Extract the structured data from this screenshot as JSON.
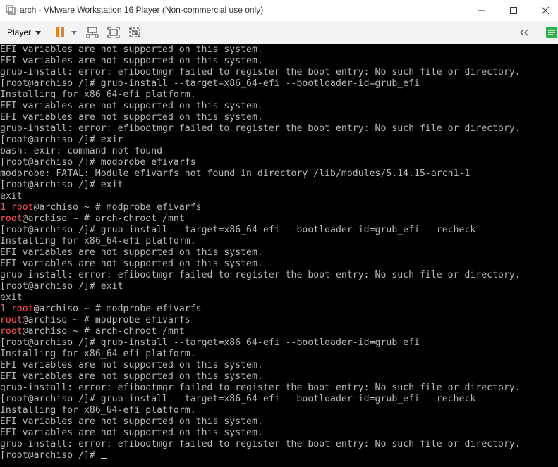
{
  "window": {
    "title": "arch - VMware Workstation 16 Player (Non-commercial use only)"
  },
  "toolbar": {
    "player_label": "Player"
  },
  "colors": {
    "terminal_bg": "#000000",
    "terminal_fg": "#b8b8b8",
    "prompt_red": "#ff5555",
    "pause_orange": "#f07a1a",
    "sidebar_green": "#2fb24c"
  },
  "terminal": {
    "lines": [
      {
        "t": "EFI variables are not supported on this system."
      },
      {
        "t": "EFI variables are not supported on this system."
      },
      {
        "t": "grub-install: error: efibootmgr failed to register the boot entry: No such file or directory."
      },
      {
        "t": "[root@archiso /]# grub-install --target=x86_64-efi --bootloader-id=grub_efi"
      },
      {
        "t": "Installing for x86_64-efi platform."
      },
      {
        "t": "EFI variables are not supported on this system."
      },
      {
        "t": "EFI variables are not supported on this system."
      },
      {
        "t": "grub-install: error: efibootmgr failed to register the boot entry: No such file or directory."
      },
      {
        "t": "[root@archiso /]# exir"
      },
      {
        "t": "bash: exir: command not found"
      },
      {
        "t": "[root@archiso /]# modprobe efivarfs"
      },
      {
        "t": "modprobe: FATAL: Module efivarfs not found in directory /lib/modules/5.14.15-arch1-1"
      },
      {
        "t": "[root@archiso /]# exit"
      },
      {
        "t": "exit"
      },
      {
        "r": "1 root",
        "t": "@archiso ~ # modprobe efivarfs"
      },
      {
        "r": "root",
        "t": "@archiso ~ # arch-chroot /mnt"
      },
      {
        "t": "[root@archiso /]# grub-install --target=x86_64-efi --bootloader-id=grub_efi --recheck"
      },
      {
        "t": "Installing for x86_64-efi platform."
      },
      {
        "t": "EFI variables are not supported on this system."
      },
      {
        "t": "EFI variables are not supported on this system."
      },
      {
        "t": "grub-install: error: efibootmgr failed to register the boot entry: No such file or directory."
      },
      {
        "t": "[root@archiso /]# exit"
      },
      {
        "t": "exit"
      },
      {
        "r": "1 root",
        "t": "@archiso ~ # modprobe efivarfs"
      },
      {
        "r": "root",
        "t": "@archiso ~ # modprobe efivarfs"
      },
      {
        "r": "root",
        "t": "@archiso ~ # arch-chroot /mnt"
      },
      {
        "t": "[root@archiso /]# grub-install --target=x86_64-efi --bootloader-id=grub_efi"
      },
      {
        "t": "Installing for x86_64-efi platform."
      },
      {
        "t": "EFI variables are not supported on this system."
      },
      {
        "t": "EFI variables are not supported on this system."
      },
      {
        "t": "grub-install: error: efibootmgr failed to register the boot entry: No such file or directory."
      },
      {
        "t": "[root@archiso /]# grub-install --target=x86_64-efi --bootloader-id=grub_efi --recheck"
      },
      {
        "t": "Installing for x86_64-efi platform."
      },
      {
        "t": "EFI variables are not supported on this system."
      },
      {
        "t": "EFI variables are not supported on this system."
      },
      {
        "t": "grub-install: error: efibootmgr failed to register the boot entry: No such file or directory."
      },
      {
        "t": "[root@archiso /]# ",
        "cursor": true
      }
    ]
  }
}
